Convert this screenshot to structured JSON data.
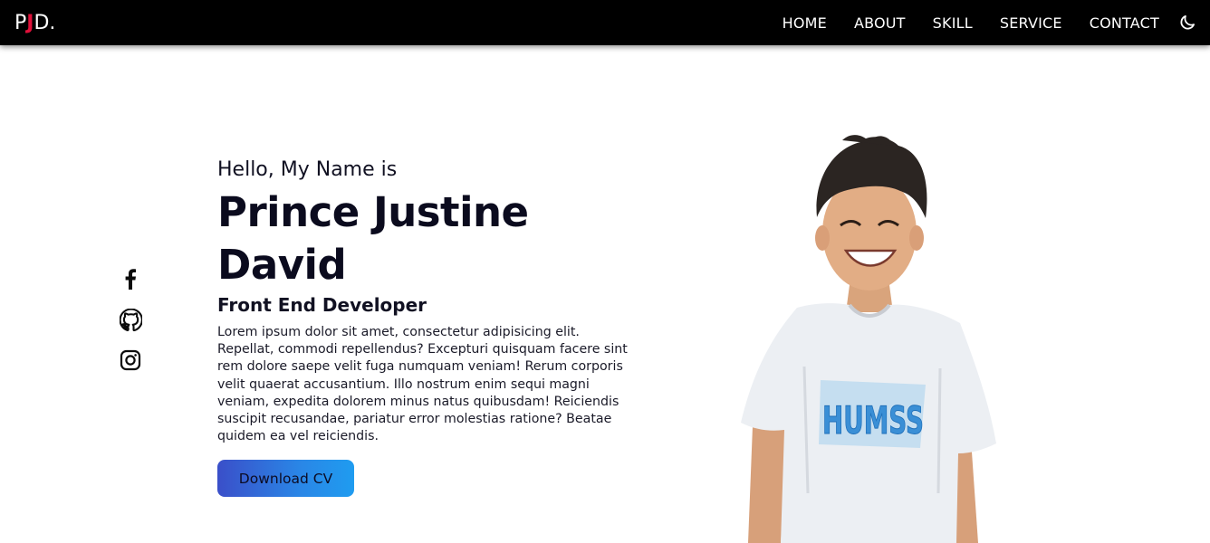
{
  "header": {
    "logo": {
      "prefix": "P",
      "accent": "J",
      "suffix": "D."
    },
    "nav": [
      {
        "label": "HOME"
      },
      {
        "label": "ABOUT"
      },
      {
        "label": "SKILL"
      },
      {
        "label": "SERVICE"
      },
      {
        "label": "CONTACT"
      }
    ],
    "theme_toggle_icon": "moon-icon"
  },
  "socials": [
    {
      "icon": "facebook-icon"
    },
    {
      "icon": "github-icon"
    },
    {
      "icon": "instagram-icon"
    }
  ],
  "hero": {
    "greeting": "Hello, My Name is",
    "name_line1": "Prince Justine",
    "name_line2": "David",
    "role": "Front End Developer",
    "bio": "Lorem ipsum dolor sit amet, consectetur adipisicing elit. Repellat, commodi repellendus? Excepturi quisquam facere sint rem dolore saepe velit fuga numquam veniam! Rerum corporis velit quaerat accusantium. Illo nostrum enim sequi magni veniam, expedita dolorem minus natus quibusdam! Reiciendis suscipit recusandae, pariatur error molestias ratione? Beatae quidem ea vel reiciendis.",
    "cv_button": "Download CV",
    "shirt_text": "HUMSS"
  },
  "colors": {
    "nav_bg": "#000000",
    "logo_accent": "#e0103a",
    "button_gradient_start": "#3a4fc9",
    "button_gradient_end": "#1f9cf0",
    "text_dark": "#0b0b1e"
  }
}
